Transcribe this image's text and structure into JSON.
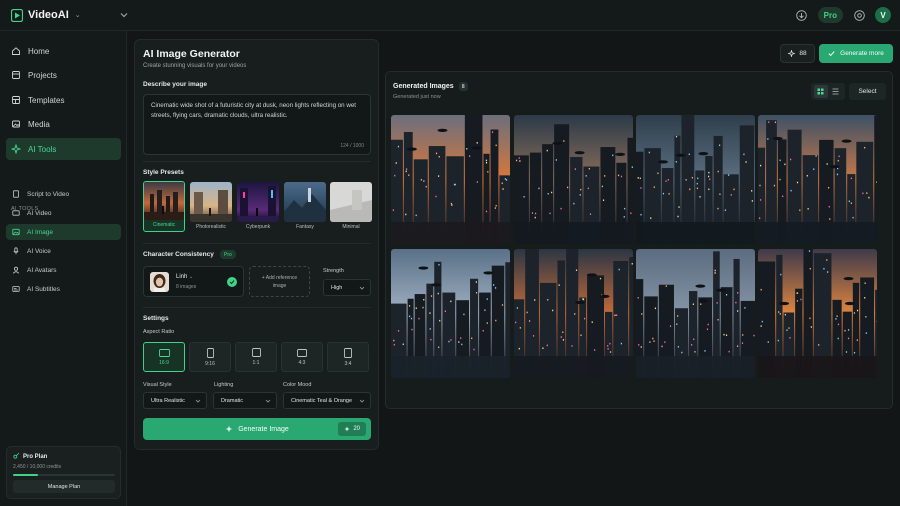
{
  "app": {
    "name": "VideoAI"
  },
  "topbar": {
    "plan_badge": "Pro",
    "avatar_initial": "V"
  },
  "sidebar": {
    "nav": [
      {
        "label": "Home",
        "icon": "home-icon"
      },
      {
        "label": "Projects",
        "icon": "folder-icon"
      },
      {
        "label": "Templates",
        "icon": "template-icon"
      },
      {
        "label": "Media",
        "icon": "media-icon"
      },
      {
        "label": "AI Tools",
        "icon": "sparkle-icon",
        "active": true
      }
    ],
    "tools_heading": "AI TOOLS",
    "tools": [
      {
        "label": "Script to Video"
      },
      {
        "label": "AI Video"
      },
      {
        "label": "AI Image",
        "active": true
      },
      {
        "label": "AI Voice"
      },
      {
        "label": "AI Avatars"
      },
      {
        "label": "AI Subtitles"
      }
    ],
    "plan": {
      "title": "Pro Plan",
      "credits": "2,450 / 10,000 credits",
      "used_fraction": 0.245,
      "button": "Manage Plan"
    }
  },
  "generator": {
    "title": "AI Image Generator",
    "subtitle": "Create stunning visuals for your videos",
    "prompt_label": "Describe your image",
    "prompt_value": "Cinematic wide shot of a futuristic city at dusk, neon lights reflecting on wet streets, flying cars, dramatic clouds, ultra realistic.",
    "char_count": "124 / 1000",
    "presets_label": "Style Presets",
    "presets": [
      {
        "label": "Cinematic",
        "selected": true
      },
      {
        "label": "Photorealistic"
      },
      {
        "label": "Cyberpunk"
      },
      {
        "label": "Fantasy"
      },
      {
        "label": "Minimal"
      }
    ],
    "character": {
      "label": "Character Consistency",
      "badge": "Pro",
      "name": "Linh",
      "images": "8 images",
      "add_ref": "+ Add reference image",
      "strength_label": "Strength",
      "strength_value": "High"
    },
    "settings_label": "Settings",
    "aspect_label": "Aspect Ratio",
    "aspects": [
      {
        "label": "16:9",
        "selected": true
      },
      {
        "label": "9:16"
      },
      {
        "label": "1:1"
      },
      {
        "label": "4:3"
      },
      {
        "label": "3:4"
      }
    ],
    "visual_style": {
      "label": "Visual Style",
      "value": "Ultra Realistic"
    },
    "lighting": {
      "label": "Lighting",
      "value": "Dramatic"
    },
    "color_mood": {
      "label": "Color Mood",
      "value": "Cinematic Teal & Orange"
    },
    "generate_label": "Generate Image",
    "generate_cost": "20"
  },
  "results": {
    "credits": "88",
    "generate_more": "Generate more",
    "title": "Generated Images",
    "count": "8",
    "subtitle": "Generated just now",
    "select_label": "Select"
  },
  "colors": {
    "accent": "#2aa871",
    "accent_text": "#48d890",
    "bg": "#121616",
    "panel": "#181e1e"
  }
}
